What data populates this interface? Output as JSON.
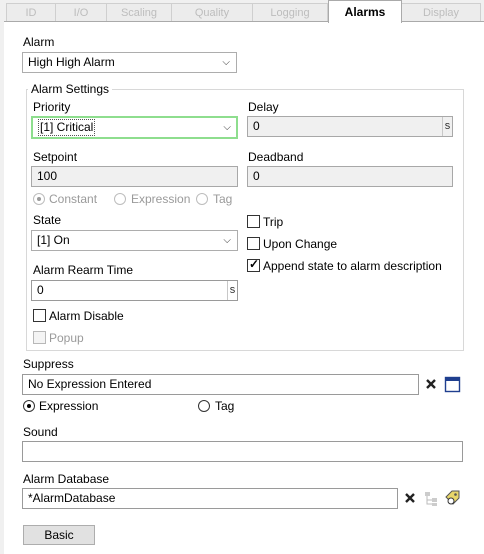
{
  "tabs": [
    "ID",
    "I/O",
    "Scaling",
    "Quality",
    "Logging",
    "Alarms",
    "Display"
  ],
  "alarm": {
    "label": "Alarm",
    "value": "High High Alarm"
  },
  "settings": {
    "title": "Alarm Settings",
    "priority_label": "Priority",
    "priority_value": "[1] Critical",
    "delay_label": "Delay",
    "delay_value": "0",
    "delay_unit": "s",
    "setpoint_label": "Setpoint",
    "setpoint_value": "100",
    "deadband_label": "Deadband",
    "deadband_value": "0",
    "mode_options": [
      "Constant",
      "Expression",
      "Tag"
    ],
    "state_label": "State",
    "state_value": "[1] On",
    "trip_label": "Trip",
    "upon_change_label": "Upon Change",
    "append_label": "Append state to alarm description",
    "rearm_label": "Alarm Rearm Time",
    "rearm_value": "0",
    "rearm_unit": "s",
    "disable_label": "Alarm Disable",
    "popup_label": "Popup"
  },
  "suppress": {
    "label": "Suppress",
    "value": "No Expression Entered",
    "opt_expression": "Expression",
    "opt_tag": "Tag"
  },
  "sound": {
    "label": "Sound",
    "value": ""
  },
  "database": {
    "label": "Alarm Database",
    "value": "*AlarmDatabase"
  },
  "basic_button": "Basic"
}
